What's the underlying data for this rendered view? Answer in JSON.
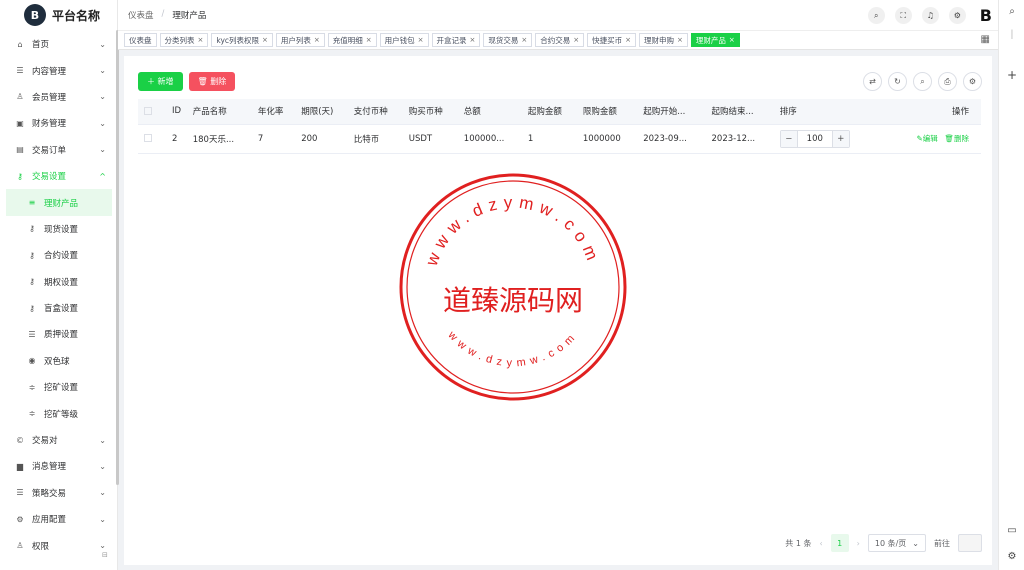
{
  "app": {
    "title": "平台名称",
    "logo_glyph": "B"
  },
  "breadcrumb": [
    "仪表盘",
    "理财产品"
  ],
  "sidebar": {
    "items": [
      {
        "label": "首页",
        "icon": "home-icon",
        "glyph": "⌂",
        "arrow": "⌄"
      },
      {
        "label": "内容管理",
        "icon": "list-icon",
        "glyph": "☰",
        "arrow": "⌄"
      },
      {
        "label": "会员管理",
        "icon": "user-icon",
        "glyph": "♙",
        "arrow": "⌄"
      },
      {
        "label": "财务管理",
        "icon": "finance-icon",
        "glyph": "▣",
        "arrow": "⌄"
      },
      {
        "label": "交易订单",
        "icon": "order-icon",
        "glyph": "▤",
        "arrow": "⌄"
      },
      {
        "label": "交易设置",
        "icon": "key-icon",
        "glyph": "⚷",
        "arrow": "^",
        "expanded": true
      },
      {
        "label": "理财产品",
        "icon": "list-icon",
        "glyph": "≡",
        "active": true
      },
      {
        "label": "现货设置",
        "icon": "key-icon",
        "glyph": "⚷"
      },
      {
        "label": "合约设置",
        "icon": "key-icon",
        "glyph": "⚷"
      },
      {
        "label": "期权设置",
        "icon": "key-icon",
        "glyph": "⚷"
      },
      {
        "label": "盲盒设置",
        "icon": "key-icon",
        "glyph": "⚷"
      },
      {
        "label": "质押设置",
        "icon": "list-icon",
        "glyph": "☰"
      },
      {
        "label": "双色球",
        "icon": "ball-icon",
        "glyph": "◉"
      },
      {
        "label": "挖矿设置",
        "icon": "filter-icon",
        "glyph": "≑"
      },
      {
        "label": "挖矿等级",
        "icon": "filter-icon",
        "glyph": "≑"
      },
      {
        "label": "交易对",
        "icon": "copyright-icon",
        "glyph": "©",
        "arrow": "⌄"
      },
      {
        "label": "消息管理",
        "icon": "message-icon",
        "glyph": "▆",
        "arrow": "⌄"
      },
      {
        "label": "策略交易",
        "icon": "list-icon",
        "glyph": "☰",
        "arrow": "⌄"
      },
      {
        "label": "应用配置",
        "icon": "config-icon",
        "glyph": "⚙",
        "arrow": "⌄"
      },
      {
        "label": "权限",
        "icon": "permission-icon",
        "glyph": "♙",
        "arrow": "⌄"
      }
    ]
  },
  "tabs": [
    {
      "label": "仪表盘",
      "closable": false
    },
    {
      "label": "分类列表",
      "closable": true
    },
    {
      "label": "kyc列表权限",
      "closable": true
    },
    {
      "label": "用户列表",
      "closable": true
    },
    {
      "label": "充值明细",
      "closable": true
    },
    {
      "label": "用户钱包",
      "closable": true
    },
    {
      "label": "开盒记录",
      "closable": true
    },
    {
      "label": "现货交易",
      "closable": true
    },
    {
      "label": "合约交易",
      "closable": true
    },
    {
      "label": "快捷买币",
      "closable": true
    },
    {
      "label": "理财申购",
      "closable": true
    },
    {
      "label": "理财产品",
      "closable": true,
      "active": true
    }
  ],
  "toolbar": {
    "add_label": "＋ 新增",
    "delete_label": "🗑 删除"
  },
  "table": {
    "columns": [
      "",
      "ID",
      "产品名称",
      "年化率",
      "期限(天)",
      "支付币种",
      "购买币种",
      "总额",
      "起购金额",
      "限购金额",
      "起购开始...",
      "起购结束...",
      "排序",
      "操作"
    ],
    "rows": [
      {
        "id": "2",
        "name": "180天乐...",
        "rate": "7",
        "days": "200",
        "pay": "比特币",
        "buy": "USDT",
        "total": "100000...",
        "min": "1",
        "max": "1000000",
        "start": "2023-09...",
        "end": "2023-12...",
        "sort": "100",
        "edit": "✎编辑",
        "delete": "🗑删除"
      }
    ]
  },
  "stepper": {
    "minus": "−",
    "plus": "+"
  },
  "pagination": {
    "total": "共 1 条",
    "prev": "‹",
    "page": "1",
    "next": "›",
    "size": "10 条/页",
    "goto": "前往"
  },
  "watermark": {
    "center": "道臻源码网",
    "top_arc": "www.dzymw.com",
    "bottom_arc": "www.dzymw.com",
    "color": "#e02020"
  },
  "colors": {
    "accent": "#1ad046",
    "danger": "#f5515f"
  }
}
